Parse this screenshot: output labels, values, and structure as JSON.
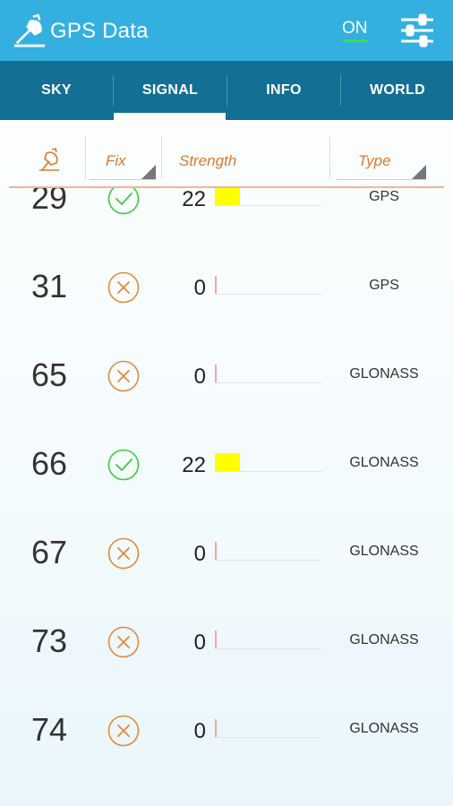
{
  "app": {
    "title": "GPS Data",
    "toggle_label": "ON"
  },
  "tabs": [
    {
      "label": "SKY",
      "active": false
    },
    {
      "label": "SIGNAL",
      "active": true
    },
    {
      "label": "INFO",
      "active": false
    },
    {
      "label": "WORLD",
      "active": false
    }
  ],
  "table": {
    "columns": {
      "fix": "Fix",
      "strength": "Strength",
      "type": "Type"
    },
    "rows": [
      {
        "prn": "29",
        "fix": true,
        "strength": "22",
        "type": "GPS"
      },
      {
        "prn": "31",
        "fix": false,
        "strength": "0",
        "type": "GPS"
      },
      {
        "prn": "65",
        "fix": false,
        "strength": "0",
        "type": "GLONASS"
      },
      {
        "prn": "66",
        "fix": true,
        "strength": "22",
        "type": "GLONASS"
      },
      {
        "prn": "67",
        "fix": false,
        "strength": "0",
        "type": "GLONASS"
      },
      {
        "prn": "73",
        "fix": false,
        "strength": "0",
        "type": "GLONASS"
      },
      {
        "prn": "74",
        "fix": false,
        "strength": "0",
        "type": "GLONASS"
      }
    ]
  },
  "colors": {
    "appbar": "#33b0e0",
    "tabbar": "#136f94",
    "accent": "#d97a2c",
    "fix_ok": "#3ccb3c",
    "fix_no": "#e08a3c",
    "bar": "#ffff00",
    "toggle_on": "#3ddc3d"
  },
  "icons": {
    "logo": "satellite-dish-icon",
    "settings": "sliders-icon",
    "header_sat": "satellite-dish-icon",
    "fix_ok": "check-circle-icon",
    "fix_no": "x-circle-icon"
  }
}
